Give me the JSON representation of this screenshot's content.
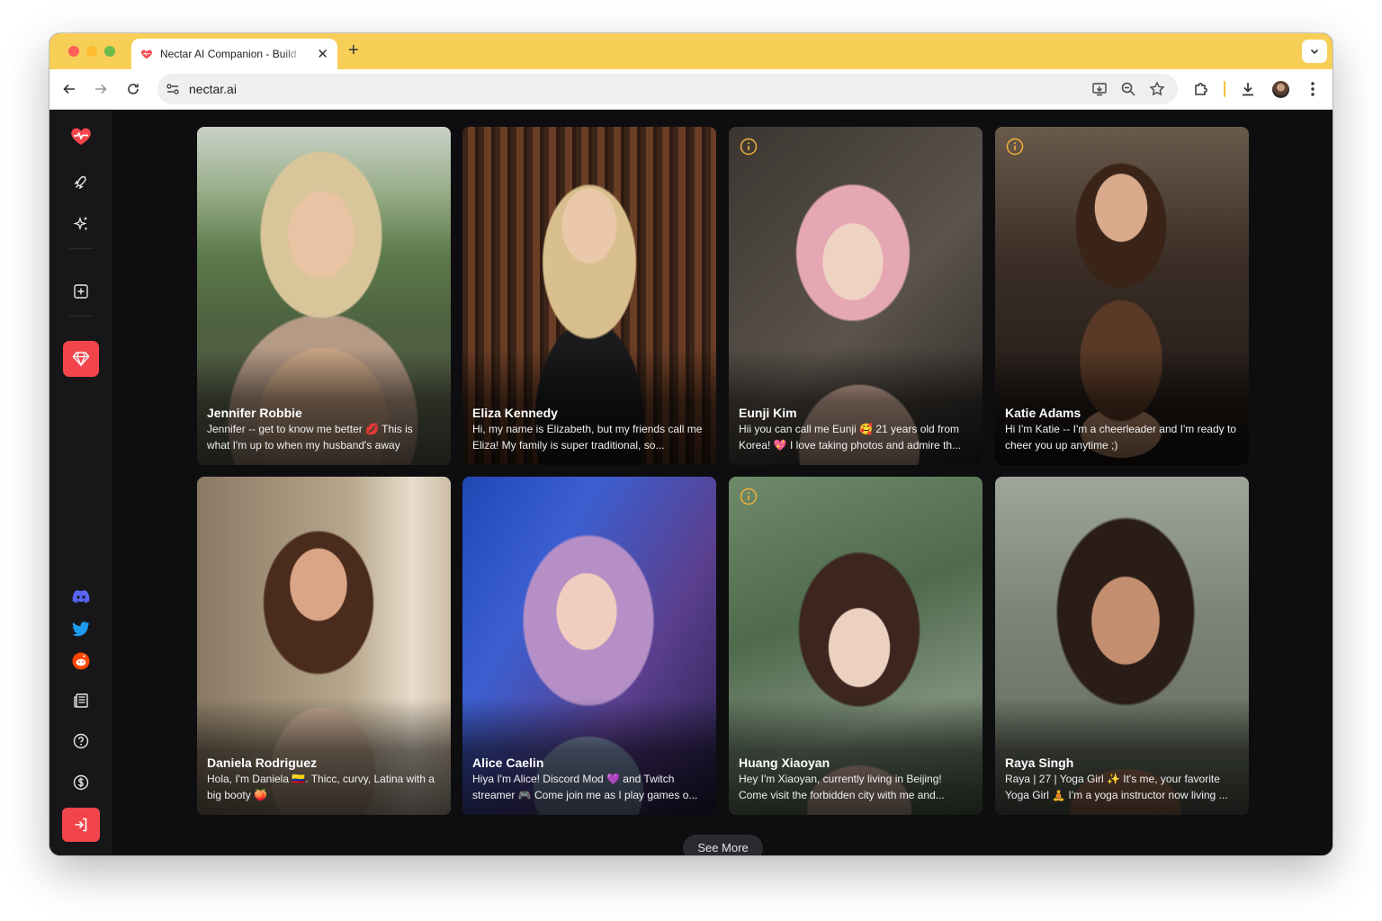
{
  "browser": {
    "tab_title": "Nectar AI Companion - Build",
    "url": "nectar.ai",
    "accent_color": "#f7cf57"
  },
  "sidebar": {
    "top_items": [
      {
        "icon": "heart-pulse-icon"
      },
      {
        "icon": "rocket-icon"
      },
      {
        "icon": "sparkles-icon"
      },
      {
        "icon": "plus-square-icon"
      },
      {
        "icon": "gem-icon"
      }
    ],
    "bottom_items": [
      {
        "icon": "discord-icon"
      },
      {
        "icon": "twitter-icon"
      },
      {
        "icon": "reddit-icon"
      },
      {
        "icon": "newspaper-icon"
      },
      {
        "icon": "help-icon"
      },
      {
        "icon": "dollar-icon"
      },
      {
        "icon": "sign-in-icon"
      }
    ],
    "brand_color": "#f2454b"
  },
  "cards": [
    {
      "name": "Jennifer Robbie",
      "description": "Jennifer -- get to know me better 💋 This is what I'm up to when my husband's away",
      "info": false
    },
    {
      "name": "Eliza Kennedy",
      "description": "Hi, my name is Elizabeth, but my friends call me Eliza! My family is super traditional, so...",
      "info": false
    },
    {
      "name": "Eunji Kim",
      "description": "Hii you can call me Eunji 🥰 21 years old from Korea! 💖 I love taking photos and admire th...",
      "info": true
    },
    {
      "name": "Katie Adams",
      "description": "Hi I'm Katie -- I'm a cheerleader and I'm ready to cheer you up anytime ;)",
      "info": true
    },
    {
      "name": "Daniela Rodriguez",
      "description": "Hola, I'm Daniela 🇨🇴. Thicc, curvy, Latina with a big booty 🍑",
      "info": false
    },
    {
      "name": "Alice Caelin",
      "description": "Hiya I'm Alice! Discord Mod 💜 and Twitch streamer 🎮 Come join me as I play games o...",
      "info": false
    },
    {
      "name": "Huang Xiaoyan",
      "description": "Hey I'm Xiaoyan, currently living in Beijing! Come visit the forbidden city with me and...",
      "info": true
    },
    {
      "name": "Raya Singh",
      "description": "Raya | 27 | Yoga Girl ✨ It's me, your favorite Yoga Girl 🧘 I'm a yoga instructor now living ...",
      "info": false
    }
  ],
  "see_more_label": "See More"
}
